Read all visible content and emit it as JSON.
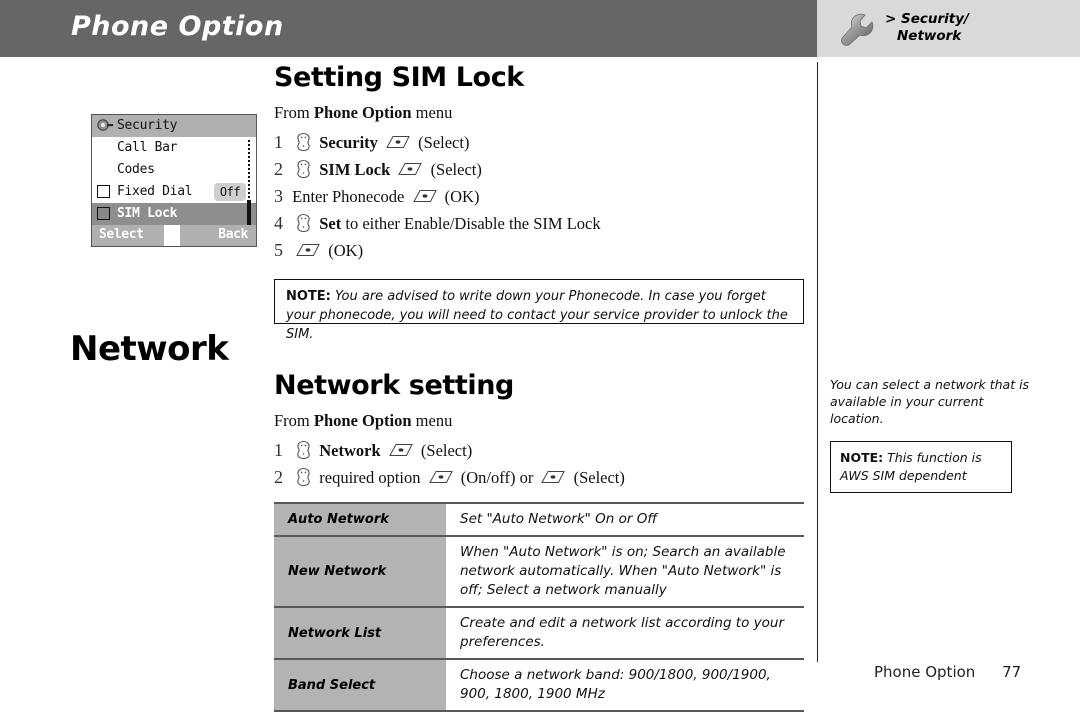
{
  "header": {
    "title": "Phone Option",
    "breadcrumb_line1": "> Security/",
    "breadcrumb_line2": "Network",
    "icon": "wrench-icon",
    "bar_color": "#666666",
    "right_bg_color": "#d9d9d9"
  },
  "phone_mock": {
    "title": "Security",
    "title_icon": "padlock-icon",
    "rows": [
      {
        "label": "Call Bar",
        "checkbox": false
      },
      {
        "label": "Codes",
        "checkbox": false
      },
      {
        "label": "Fixed Dial",
        "checkbox": true,
        "checked": false,
        "badge": "Off"
      },
      {
        "label": "SIM Lock",
        "checkbox": true,
        "checked": true,
        "selected": true
      }
    ],
    "softkey_left": "Select",
    "softkey_right": "Back"
  },
  "section_sim": {
    "heading": "Setting SIM Lock",
    "from_prefix": "From ",
    "from_bold": "Phone Option",
    "from_suffix": " menu",
    "steps": [
      {
        "num": "1",
        "nav_icon": true,
        "bold": "Security",
        "text": "",
        "soft_icon": true,
        "tail": "(Select)"
      },
      {
        "num": "2",
        "nav_icon": true,
        "bold": "SIM Lock",
        "text": "",
        "soft_icon": true,
        "tail": "(Select)"
      },
      {
        "num": "3",
        "nav_icon": false,
        "bold": "",
        "text": "Enter Phonecode",
        "soft_icon": true,
        "tail": "(OK)"
      },
      {
        "num": "4",
        "nav_icon": true,
        "bold": "Set",
        "text": " to either Enable/Disable the SIM Lock",
        "soft_icon": false,
        "tail": ""
      },
      {
        "num": "5",
        "nav_icon": false,
        "bold": "",
        "text": "",
        "soft_icon": true,
        "tail": "(OK)"
      }
    ],
    "note_label": "NOTE:",
    "note_text": " You are advised to write down your Phonecode. In case you forget your phonecode, you will need to contact your service provider to unlock the SIM."
  },
  "section_network": {
    "big_heading": "Network",
    "heading": "Network setting",
    "from_prefix": "From ",
    "from_bold": "Phone Option",
    "from_suffix": " menu",
    "steps": [
      {
        "num": "1",
        "nav_icon": true,
        "bold": "Network",
        "text": "",
        "soft_icon": true,
        "tail": "(Select)"
      },
      {
        "num": "2",
        "nav_icon": true,
        "bold": "",
        "text": "required option",
        "soft_icon": true,
        "tail": "(On/off) or",
        "soft_icon2": true,
        "tail2": "(Select)"
      }
    ],
    "table": {
      "rows": [
        {
          "key": "Auto Network",
          "value": "Set \"Auto Network\" On or Off"
        },
        {
          "key": "New Network",
          "value": "When \"Auto Network\" is on; Search an available network automatically. When \"Auto Network\" is off; Select a network manually"
        },
        {
          "key": "Network List",
          "value": "Create and edit a network list according to your preferences."
        },
        {
          "key": "Band Select",
          "value": "Choose a network band: 900/1800, 900/1900, 900, 1800, 1900 MHz"
        }
      ]
    }
  },
  "rail": {
    "tip_text": "You can select a network that is available in your current location.",
    "note_label": "NOTE:",
    "note_text": " This function is AWS SIM dependent"
  },
  "footer": {
    "section": "Phone Option",
    "page": "77"
  }
}
